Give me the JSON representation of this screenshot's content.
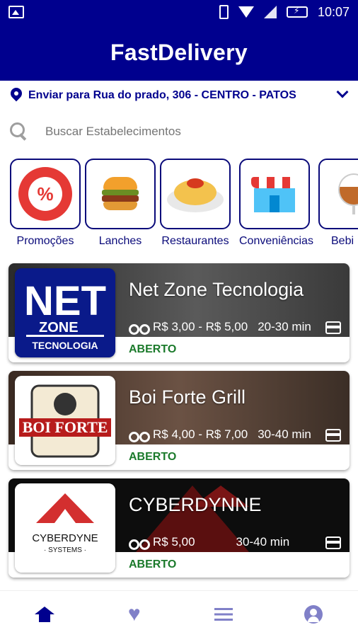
{
  "status_bar": {
    "time": "10:07"
  },
  "app": {
    "title": "FastDelivery"
  },
  "address": {
    "text": "Enviar para Rua do prado, 306 -  CENTRO - PATOS"
  },
  "search": {
    "placeholder": "Buscar Estabelecimentos"
  },
  "categories": [
    {
      "label": "Promoções",
      "icon": "percent-badge-icon"
    },
    {
      "label": "Lanches",
      "icon": "burger-icon"
    },
    {
      "label": "Restaurantes",
      "icon": "pasta-icon"
    },
    {
      "label": "Conveniências",
      "icon": "store-icon"
    },
    {
      "label": "Bebi",
      "icon": "drink-glass-icon"
    }
  ],
  "stores": [
    {
      "name": "Net Zone Tecnologia",
      "fee": "R$ 3,00 - R$ 5,00",
      "time": "20-30 min",
      "status": "ABERTO",
      "logo_text": "NET ZONE TECNOLOGIA",
      "accent": "#0a1a8a"
    },
    {
      "name": "Boi Forte Grill",
      "fee": "R$ 4,00 - R$ 7,00",
      "time": "30-40 min",
      "status": "ABERTO",
      "logo_text": "BOI FORTE",
      "accent": "#c62828"
    },
    {
      "name": "CYBERDYNNE",
      "fee": "R$ 5,00",
      "time": "30-40 min",
      "status": "ABERTO",
      "logo_text": "CYBERDYNE SYSTEMS",
      "accent": "#d32f2f"
    }
  ],
  "nav": [
    {
      "name": "home",
      "icon": "home-icon"
    },
    {
      "name": "favorites",
      "icon": "heart-icon"
    },
    {
      "name": "orders",
      "icon": "list-icon"
    },
    {
      "name": "profile",
      "icon": "account-icon"
    }
  ],
  "colors": {
    "primary": "#00008e",
    "open_status": "#1b7a2b",
    "nav_inactive": "#8080c8"
  }
}
